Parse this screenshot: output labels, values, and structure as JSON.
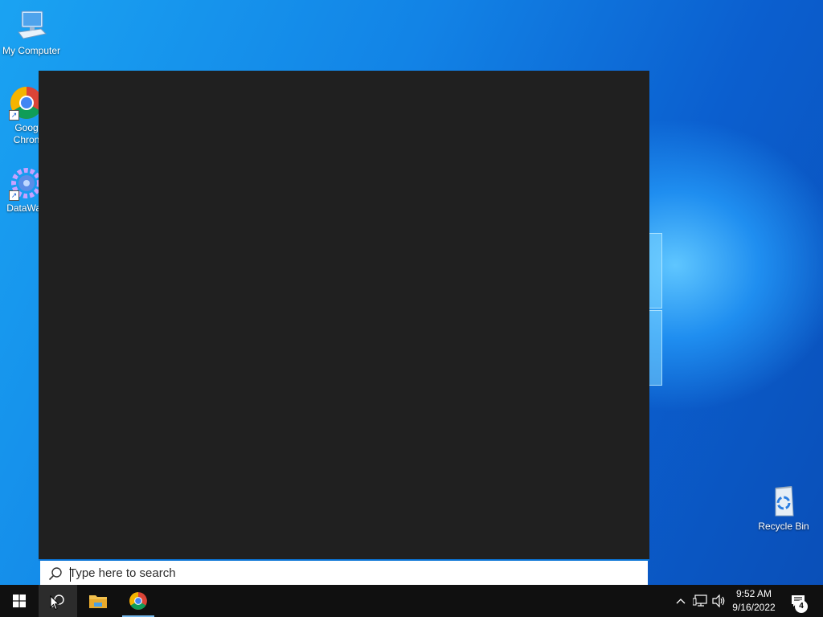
{
  "desktop": {
    "icons": [
      {
        "label": "My Computer"
      },
      {
        "label": "Goog\nChron"
      },
      {
        "label": "DataWag"
      },
      {
        "label": "Recycle Bin"
      }
    ]
  },
  "search": {
    "placeholder": "Type here to search",
    "value": ""
  },
  "taskbar": {
    "start_icon": "windows-logo-icon",
    "search_icon": "search-icon",
    "pinned": [
      {
        "name": "file-explorer-icon"
      },
      {
        "name": "chrome-icon"
      }
    ]
  },
  "tray": {
    "time": "9:52 AM",
    "date": "9/16/2022",
    "notifications": "4"
  },
  "colors": {
    "panel": "#202020",
    "taskbar": "#101010",
    "accent": "#0a74d6"
  }
}
